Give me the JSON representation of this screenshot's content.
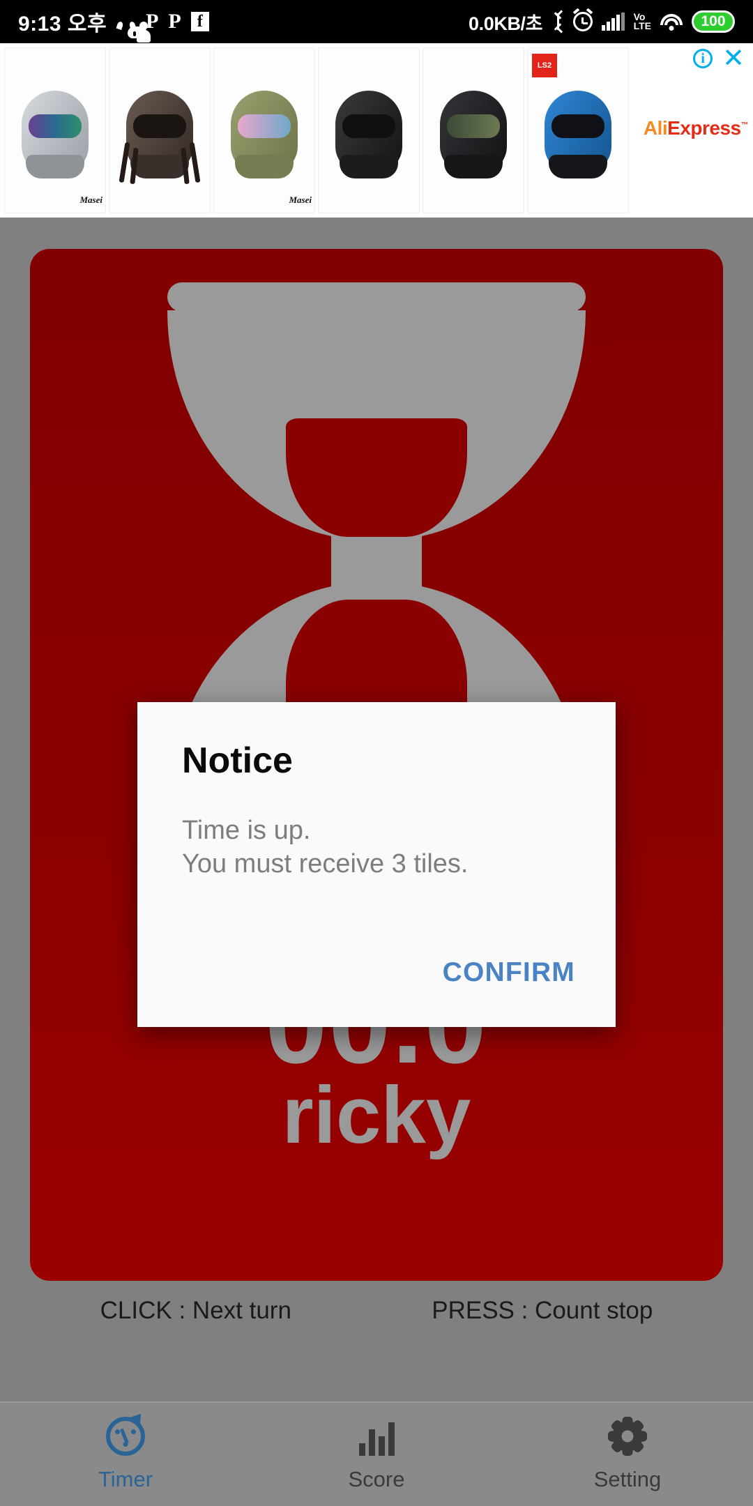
{
  "status_bar": {
    "time": "9:13 오후",
    "network_speed": "0.0KB/초",
    "battery_level": "100",
    "icons": [
      "kakaotalk-icon",
      "piggy-app-icon",
      "person-app-icon",
      "p-app-icon",
      "p2-app-icon",
      "facebook-icon",
      "bluetooth-icon",
      "alarm-icon",
      "signal-icon",
      "volte-icon",
      "wifi-icon",
      "battery-icon"
    ],
    "volte_top": "Vo",
    "volte_bottom": "LTE"
  },
  "ad": {
    "network": "AliExpress",
    "brand_part_a": "Ali",
    "brand_part_b": "Express",
    "trademark": "™",
    "info_glyph": "i",
    "close_glyph": "✕",
    "products": [
      {
        "name": "masei-silver-ironman-helmet",
        "brand": "Masei",
        "shell": "#b9bcc0",
        "visor": "#2b3a5c",
        "chin": "#8e9398"
      },
      {
        "name": "predator-dreadlocks-helmet",
        "brand": "",
        "shell": "#4a3d38",
        "visor": "#1b1512",
        "chin": "#3a302b"
      },
      {
        "name": "masei-olive-green-helmet",
        "brand": "Masei",
        "shell": "#8b9162",
        "visor": "#d6a8c4",
        "chin": "#767b52"
      },
      {
        "name": "black-tactical-mask-helmet",
        "brand": "",
        "shell": "#2b2b2b",
        "visor": "#1a1a1a",
        "chin": "#202020"
      },
      {
        "name": "stormtrooper-style-helmet",
        "brand": "",
        "shell": "#1f1f22",
        "visor": "#4a5142",
        "chin": "#17171a"
      },
      {
        "name": "ls2-blue-modular-helmet",
        "brand": "",
        "badge": "LS2",
        "shell": "#1f6fb8",
        "visor": "#121418",
        "chin": "#14161a"
      }
    ]
  },
  "game": {
    "timer_value": "00.0",
    "player_name": "ricky",
    "hourglass_icon": "hourglass-icon",
    "hints": [
      "CLICK : Next turn",
      "PRESS : Count stop"
    ]
  },
  "dialog": {
    "title": "Notice",
    "message_line1": "Time is up.",
    "message_line2": "You must receive 3 tiles.",
    "confirm_label": "CONFIRM",
    "confirm_color": "#4a83c4"
  },
  "bottom_nav": {
    "items": [
      {
        "label": "Timer",
        "icon": "timer-icon",
        "active": true
      },
      {
        "label": "Score",
        "icon": "chart-icon",
        "active": false
      },
      {
        "label": "Setting",
        "icon": "gear-icon",
        "active": false
      }
    ]
  },
  "colors": {
    "card_red": "#8a0000",
    "app_grey": "#808080",
    "accent_blue": "#2a6496",
    "battery_green": "#2ecc2e",
    "ad_cyan": "#00aeef"
  }
}
